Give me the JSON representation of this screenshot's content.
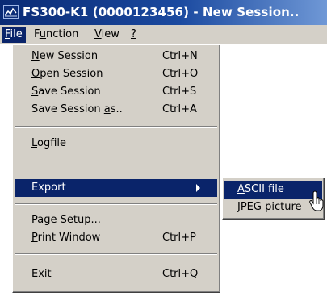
{
  "window": {
    "title": "FS300-K1 (0000123456) - New Session..",
    "icon": "app-chart-icon"
  },
  "menubar": {
    "items": [
      {
        "pre": "",
        "ul": "F",
        "post": "ile",
        "active": true
      },
      {
        "pre": "F",
        "ul": "u",
        "post": "nction",
        "active": false
      },
      {
        "pre": "",
        "ul": "V",
        "post": "iew",
        "active": false
      },
      {
        "pre": "",
        "ul": "?",
        "post": "",
        "active": false
      }
    ]
  },
  "file_menu": {
    "items": [
      {
        "pre": "",
        "ul": "N",
        "post": "ew Session",
        "shortcut": "Ctrl+N"
      },
      {
        "pre": "",
        "ul": "O",
        "post": "pen Session",
        "shortcut": "Ctrl+O"
      },
      {
        "pre": "",
        "ul": "S",
        "post": "ave Session",
        "shortcut": "Ctrl+S"
      },
      {
        "pre": "Save Session ",
        "ul": "a",
        "post": "s..",
        "shortcut": "Ctrl+A"
      },
      {
        "pre": "",
        "ul": "L",
        "post": "ogfile",
        "shortcut": ""
      },
      {
        "pre": "Export",
        "ul": "",
        "post": "",
        "shortcut": "",
        "highlighted": true
      },
      {
        "pre": "Page Se",
        "ul": "t",
        "post": "up...",
        "shortcut": ""
      },
      {
        "pre": "",
        "ul": "P",
        "post": "rint Window",
        "shortcut": "Ctrl+P"
      },
      {
        "pre": "E",
        "ul": "x",
        "post": "it",
        "shortcut": "Ctrl+Q"
      }
    ]
  },
  "export_submenu": {
    "items": [
      {
        "pre": "",
        "ul": "A",
        "post": "SCII file",
        "highlighted": true
      },
      {
        "pre": "",
        "ul": "J",
        "post": "PEG picture",
        "highlighted": false
      }
    ]
  },
  "colors": {
    "highlight": "#0a246a",
    "menu_face": "#d4d0c8",
    "title_start": "#0a2a74",
    "title_end": "#6f98d6"
  }
}
